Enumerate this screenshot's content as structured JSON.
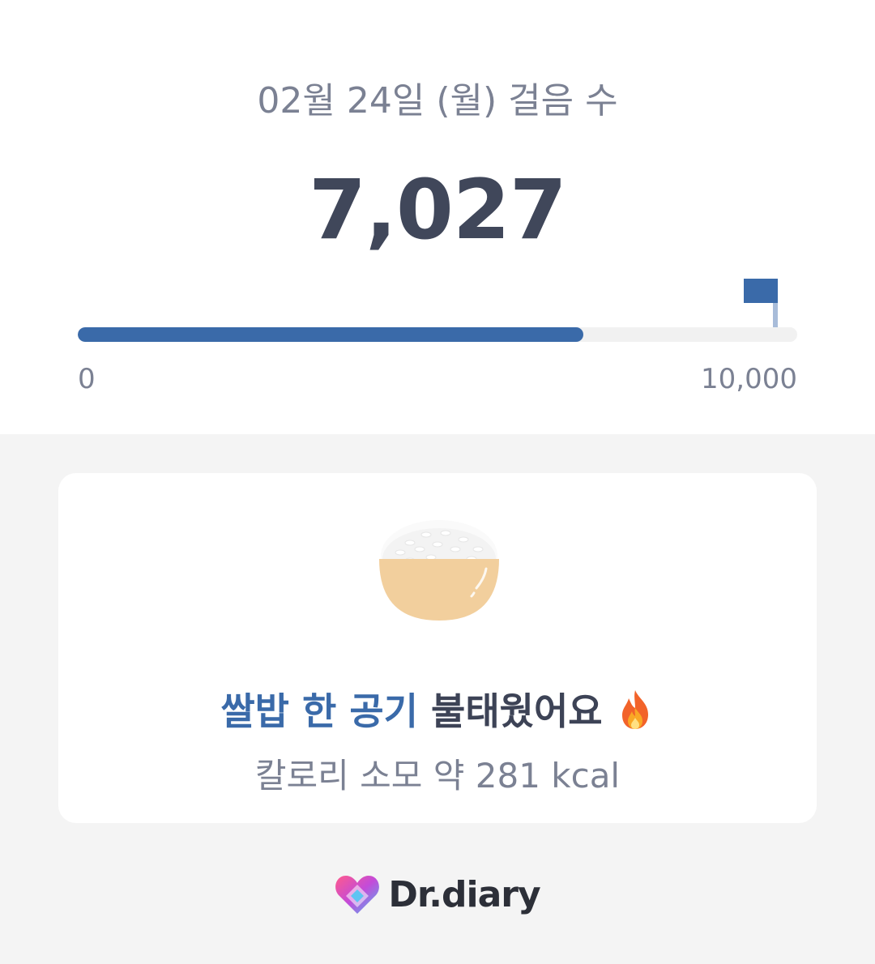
{
  "header": {
    "date_label": "02월 24일 (월) 걸음 수"
  },
  "steps": {
    "value": "7,027",
    "progress_fraction": 0.7027
  },
  "progress_axis": {
    "min_label": "0",
    "max_label": "10,000"
  },
  "card": {
    "icon": "rice-bowl-icon",
    "headline_accent": "쌀밥 한 공기",
    "headline_rest": "불태웠어요",
    "headline_emoji": "fire-icon",
    "calorie_text": "칼로리 소모 약 281 kcal"
  },
  "brand": {
    "name": "Dr.diary"
  },
  "colors": {
    "accent": "#3a6aa9",
    "text_dark": "#40475a",
    "text_muted": "#7b8193",
    "background": "#f4f4f4",
    "track": "#f1f1f1"
  }
}
